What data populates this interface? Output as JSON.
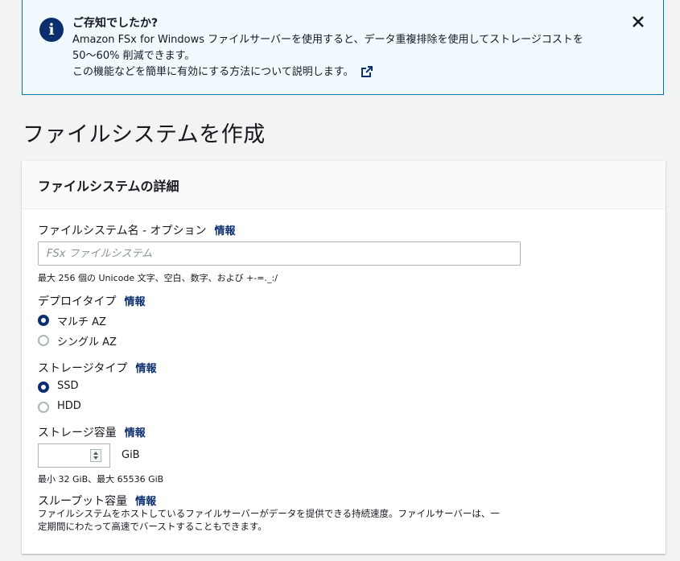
{
  "flash": {
    "title": "ご存知でしたか?",
    "line1": "Amazon FSx for Windows ファイルサーバーを使用すると、データ重複排除を使用してストレージコストを",
    "line2": "50～60% 削減できます。",
    "line3": "この機能などを簡単に有効にする方法について説明します。",
    "icon": "info-icon"
  },
  "page_title": "ファイルシステムを作成",
  "panel": {
    "header": "ファイルシステムの詳細",
    "info_label": "情報",
    "name_field": {
      "label": "ファイルシステム名 - オプション",
      "value": "",
      "placeholder": "FSx ファイルシステム",
      "hint": "最大 256 個の Unicode 文字、空白、数字、および +-=._:/"
    },
    "deployment_type": {
      "label": "デプロイタイプ",
      "options": [
        "マルチ AZ",
        "シングル AZ"
      ],
      "selected": "マルチ AZ"
    },
    "storage_type": {
      "label": "ストレージタイプ",
      "options": [
        "SSD",
        "HDD"
      ],
      "selected": "SSD"
    },
    "storage_capacity": {
      "label": "ストレージ容量",
      "value": "",
      "unit": "GiB",
      "hint": "最小 32 GiB、最大 65536 GiB"
    },
    "throughput": {
      "label": "スループット容量",
      "desc_line1": "ファイルシステムをホストしているファイルサーバーがデータを提供できる持続速度。ファイルサーバーは、一",
      "desc_line2": "定期間にわたって高速でバーストすることもできます。"
    }
  },
  "colors": {
    "accent": "#0b2e6e",
    "flash_bg": "#f1faff",
    "flash_border": "#0073bb"
  }
}
